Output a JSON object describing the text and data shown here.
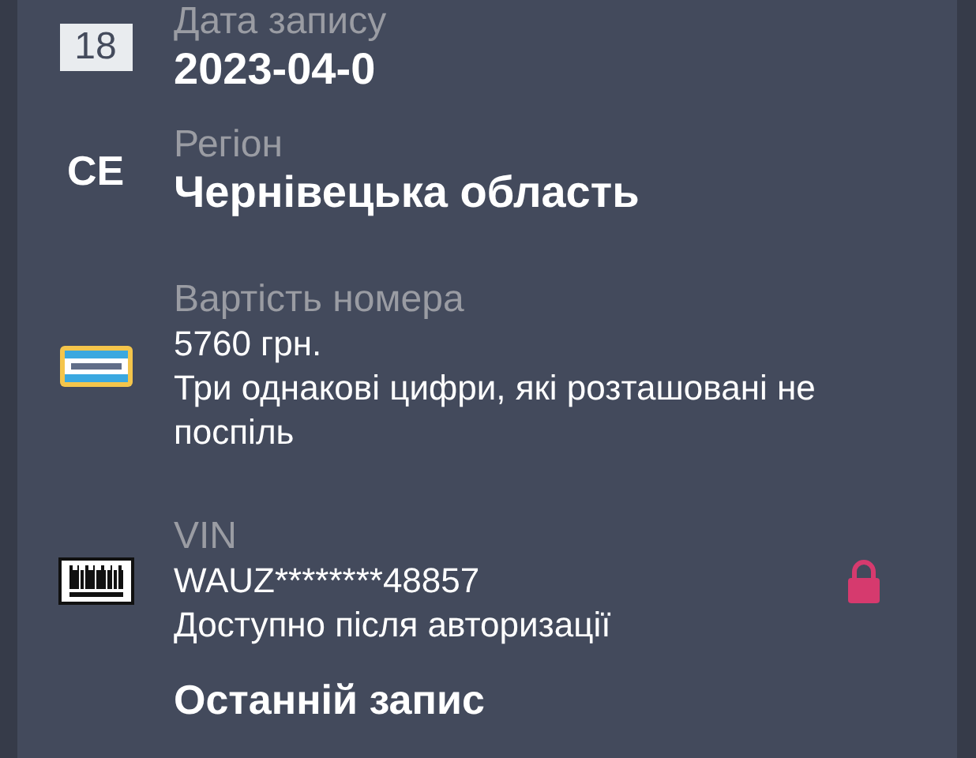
{
  "sections": [
    {
      "kind": "date",
      "icon_text": "18",
      "label": "Дата запису",
      "value": "2023-04-0"
    },
    {
      "kind": "region",
      "icon_text": "CE",
      "label": "Регіон",
      "value": "Чернівецька область"
    },
    {
      "kind": "plate",
      "label": "Вартість номера",
      "lines": [
        "5760 грн.",
        "Три однакові цифри, які розташовані не поспіль"
      ]
    },
    {
      "kind": "vin",
      "label": "VIN",
      "lines": [
        "WAUZ********48857",
        "Доступно після авторизації"
      ],
      "locked": true
    }
  ],
  "heading": "Останній запис"
}
